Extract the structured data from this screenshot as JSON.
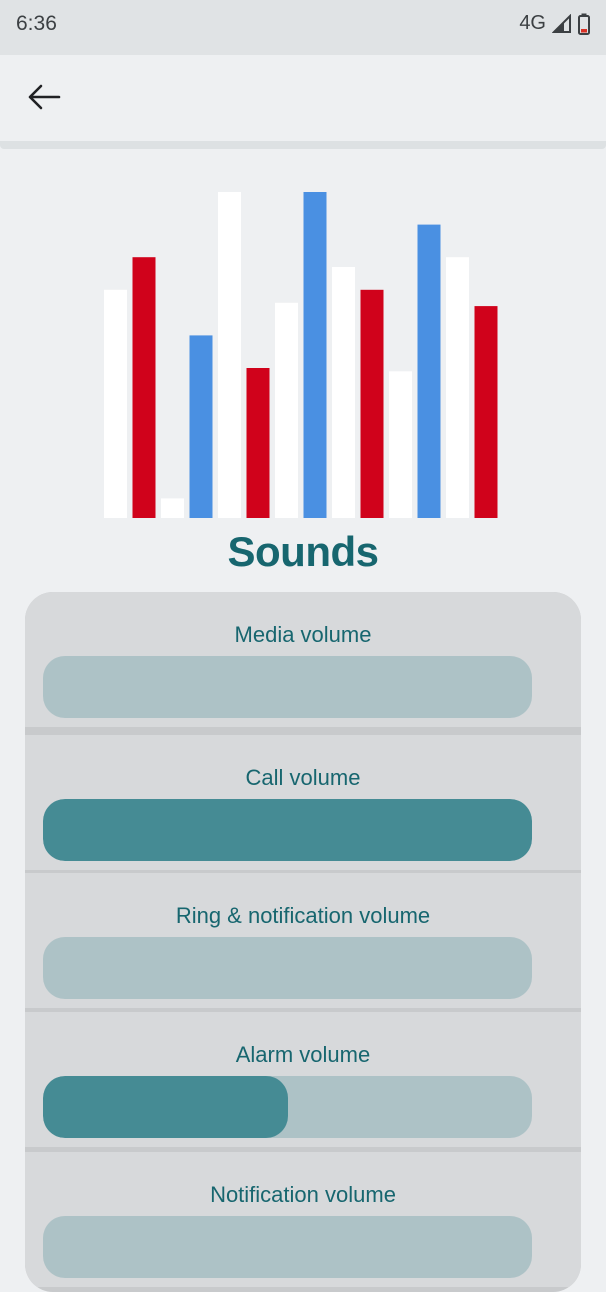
{
  "status_bar": {
    "time": "6:36",
    "network": "4G",
    "icons": [
      "signal-icon",
      "battery-icon"
    ]
  },
  "app_bar": {
    "back_icon": "arrow-back-icon"
  },
  "equalizer": {
    "icon": "equalizer-graphic",
    "colors": {
      "white": "#ffffff",
      "red": "#d0021b",
      "blue": "#4a90e2"
    },
    "bars": [
      {
        "color": "white",
        "level": 0.7
      },
      {
        "color": "red",
        "level": 0.8
      },
      {
        "color": "white",
        "level": 0.06
      },
      {
        "color": "blue",
        "level": 0.56
      },
      {
        "color": "white",
        "level": 1.0
      },
      {
        "color": "red",
        "level": 0.46
      },
      {
        "color": "white",
        "level": 0.66
      },
      {
        "color": "blue",
        "level": 1.0
      },
      {
        "color": "white",
        "level": 0.77
      },
      {
        "color": "red",
        "level": 0.7
      },
      {
        "color": "white",
        "level": 0.45
      },
      {
        "color": "blue",
        "level": 0.9
      },
      {
        "color": "white",
        "level": 0.8
      },
      {
        "color": "red",
        "level": 0.65
      }
    ]
  },
  "page": {
    "title": "Sounds"
  },
  "volumes": [
    {
      "label": "Media volume",
      "level": 0.0
    },
    {
      "label": "Call volume",
      "level": 1.0
    },
    {
      "label": "Ring & notification volume",
      "level": 0.0
    },
    {
      "label": "Alarm volume",
      "level": 0.5
    },
    {
      "label": "Notification volume",
      "level": 0.0
    }
  ],
  "colors": {
    "accent": "#17666f",
    "track": "#adc2c6",
    "fill": "#458b94",
    "card": "#d7d9db",
    "background": "#eef0f2"
  }
}
